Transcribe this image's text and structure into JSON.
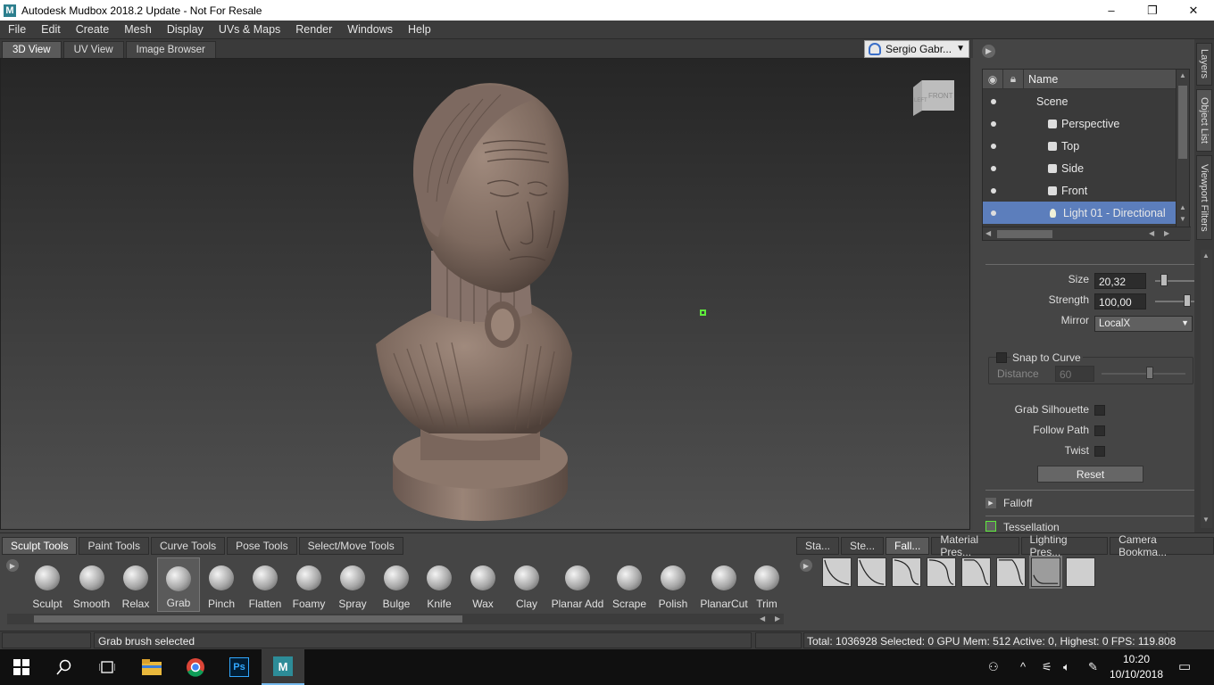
{
  "window": {
    "title": "Autodesk Mudbox 2018.2 Update - Not For Resale",
    "logo_letter": "M",
    "controls": [
      "–",
      "❐",
      "✕"
    ]
  },
  "menu": [
    "File",
    "Edit",
    "Create",
    "Mesh",
    "Display",
    "UVs & Maps",
    "Render",
    "Windows",
    "Help"
  ],
  "view_tabs": [
    {
      "label": "3D View",
      "active": true
    },
    {
      "label": "UV View",
      "active": false
    },
    {
      "label": "Image Browser",
      "active": false
    }
  ],
  "user": {
    "name": "Sergio Gabr..."
  },
  "viewport": {
    "viewcube_label": "FRONT",
    "viewcube_side": "LEFT"
  },
  "object_list": {
    "header_name": "Name",
    "items": [
      {
        "label": "Scene",
        "icon": "none",
        "selected": false
      },
      {
        "label": "Perspective",
        "icon": "camera-icon",
        "selected": false
      },
      {
        "label": "Top",
        "icon": "camera-icon",
        "selected": false
      },
      {
        "label": "Side",
        "icon": "camera-icon",
        "selected": false
      },
      {
        "label": "Front",
        "icon": "camera-icon",
        "selected": false
      },
      {
        "label": "Light 01 - Directional",
        "icon": "light-icon",
        "selected": true
      }
    ]
  },
  "properties": {
    "size_label": "Size",
    "size_value": "20,32",
    "strength_label": "Strength",
    "strength_value": "100,00",
    "mirror_label": "Mirror",
    "mirror_value": "LocalX",
    "snap_label": "Snap to Curve",
    "distance_label": "Distance",
    "distance_value": "60",
    "grab_silhouette_label": "Grab Silhouette",
    "follow_path_label": "Follow Path",
    "twist_label": "Twist",
    "reset_label": "Reset",
    "falloff_label": "Falloff",
    "tessellation_label": "Tessellation"
  },
  "side_tabs": [
    "Layers",
    "Object List",
    "Viewport Filters"
  ],
  "tool_tabs": [
    {
      "label": "Sculpt Tools",
      "active": true
    },
    {
      "label": "Paint Tools",
      "active": false
    },
    {
      "label": "Curve Tools",
      "active": false
    },
    {
      "label": "Pose Tools",
      "active": false
    },
    {
      "label": "Select/Move Tools",
      "active": false
    }
  ],
  "tools": [
    {
      "label": "Sculpt",
      "active": false
    },
    {
      "label": "Smooth",
      "active": false
    },
    {
      "label": "Relax",
      "active": false
    },
    {
      "label": "Grab",
      "active": true
    },
    {
      "label": "Pinch",
      "active": false
    },
    {
      "label": "Flatten",
      "active": false
    },
    {
      "label": "Foamy",
      "active": false
    },
    {
      "label": "Spray",
      "active": false
    },
    {
      "label": "Bulge",
      "active": false
    },
    {
      "label": "Knife",
      "active": false
    },
    {
      "label": "Wax",
      "active": false
    },
    {
      "label": "Clay",
      "active": false
    },
    {
      "label": "Planar Add",
      "active": false
    },
    {
      "label": "Scrape",
      "active": false
    },
    {
      "label": "Polish",
      "active": false
    },
    {
      "label": "PlanarCut",
      "active": false
    },
    {
      "label": "Trim",
      "active": false
    }
  ],
  "falloff_tabs": [
    {
      "label": "Sta...",
      "active": false
    },
    {
      "label": "Ste...",
      "active": false
    },
    {
      "label": "Fall...",
      "active": true
    },
    {
      "label": "Material Pres...",
      "active": false
    },
    {
      "label": "Lighting Pres...",
      "active": false
    },
    {
      "label": "Camera Bookma...",
      "active": false
    }
  ],
  "falloff_presets_selected_index": 6,
  "status": {
    "message": "Grab brush selected",
    "stats": "Total: 1036928  Selected: 0 GPU Mem: 512  Active: 0, Highest: 0  FPS: 119.808"
  },
  "taskbar": {
    "apps": [
      "start-icon",
      "search-icon",
      "task-view-icon",
      "file-explorer-icon",
      "chrome-icon",
      "photoshop-icon",
      "mudbox-icon"
    ],
    "photoshop_label": "Ps",
    "time": "10:20",
    "date": "10/10/2018"
  },
  "colors": {
    "selection": "#5c7ebc",
    "clay": "#8a7468",
    "cursor_box": "#5eea3c"
  }
}
